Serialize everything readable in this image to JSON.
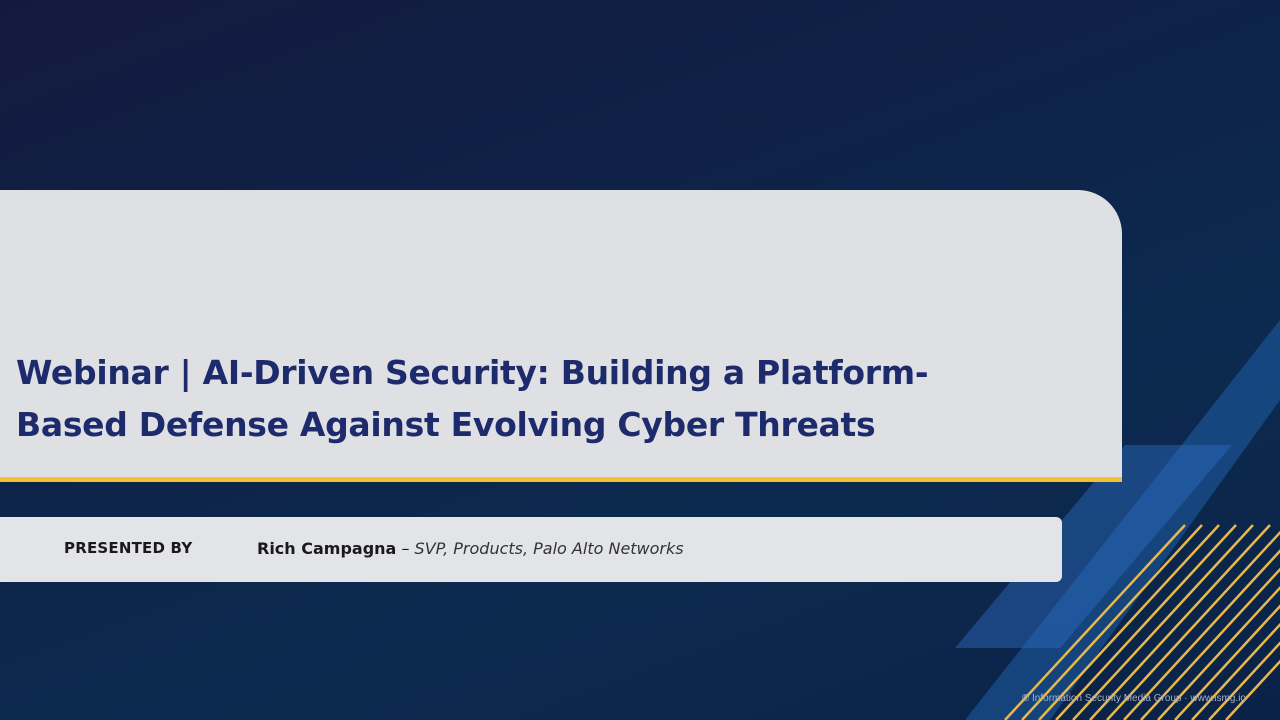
{
  "slide": {
    "title": "Webinar | AI-Driven Security: Building a Platform-Based Defense Against Evolving Cyber Threats",
    "presented_by_label": "PRESENTED BY",
    "presenter_name": "Rich Campagna",
    "presenter_dash": "–",
    "presenter_role": "SVP, Products, Palo Alto Networks",
    "copyright": "© Information Security Media Group · www.ismg.io"
  },
  "colors": {
    "background": "#0f2147",
    "card": "#dfe0e4",
    "title_text": "#1d2a6b",
    "accent_yellow": "#f1c232",
    "accent_blue": "#2d6cc0"
  }
}
